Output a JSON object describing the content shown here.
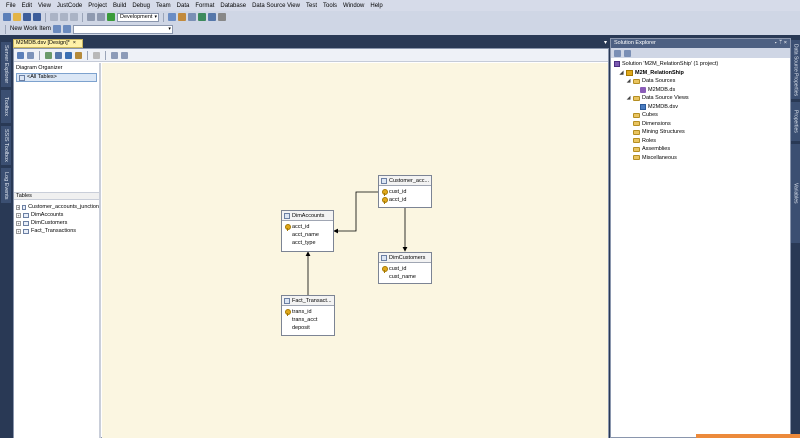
{
  "menu": [
    "File",
    "Edit",
    "View",
    "JustCode",
    "Project",
    "Build",
    "Debug",
    "Team",
    "Data",
    "Format",
    "Database",
    "Data Source View",
    "Test",
    "Tools",
    "Window",
    "Help"
  ],
  "toolbar": {
    "config_value": "Development",
    "new_work_item_label": "New Work Item"
  },
  "left_tabs": [
    "Server Explorer",
    "Toolbox",
    "SSIS Toolbox",
    "Log Events"
  ],
  "right_tabs": [
    "Data Source Properties",
    "Properties",
    "Variables"
  ],
  "document_tab": {
    "label": "M2MDB.dsv [Design]*",
    "close": "×"
  },
  "doc_tab_controls": "▾",
  "organizer": {
    "title": "Diagram Organizer",
    "all_tables": "<All Tables>",
    "tables_title": "Tables",
    "tables": [
      "Customer_accounts_junction",
      "DimAccounts",
      "DimCustomers",
      "Fact_Transactions"
    ]
  },
  "entities": {
    "customer_acc": {
      "title": "Customer_acc...",
      "columns": [
        {
          "name": "cust_id",
          "key": true
        },
        {
          "name": "acct_id",
          "key": true
        }
      ]
    },
    "dim_accounts": {
      "title": "DimAccounts",
      "columns": [
        {
          "name": "acct_id",
          "key": true
        },
        {
          "name": "acct_name",
          "key": false
        },
        {
          "name": "acct_type",
          "key": false
        }
      ]
    },
    "dim_customers": {
      "title": "DimCustomers",
      "columns": [
        {
          "name": "cust_id",
          "key": true
        },
        {
          "name": "cust_name",
          "key": false
        }
      ]
    },
    "fact_transact": {
      "title": "Fact_Transact...",
      "columns": [
        {
          "name": "trans_id",
          "key": true
        },
        {
          "name": "trans_acct",
          "key": false
        },
        {
          "name": "deposit",
          "key": false
        }
      ]
    }
  },
  "solution_explorer": {
    "title": "Solution Explorer",
    "controls": "▾ ᛘ ×",
    "solution": "Solution 'M2M_RelationShip' (1 project)",
    "project": "M2M_RelationShip",
    "data_sources": "Data Sources",
    "ds_item": "M2MDB.ds",
    "dsv": "Data Source Views",
    "dsv_item": "M2MDB.dsv",
    "folders": [
      "Cubes",
      "Dimensions",
      "Mining Structures",
      "Roles",
      "Assemblies",
      "Miscellaneous"
    ]
  },
  "colors": {
    "chrome": "#293955",
    "canvas": "#fbf6e1",
    "menubar": "#d6dbe9",
    "accent": "#ec8a3b"
  }
}
